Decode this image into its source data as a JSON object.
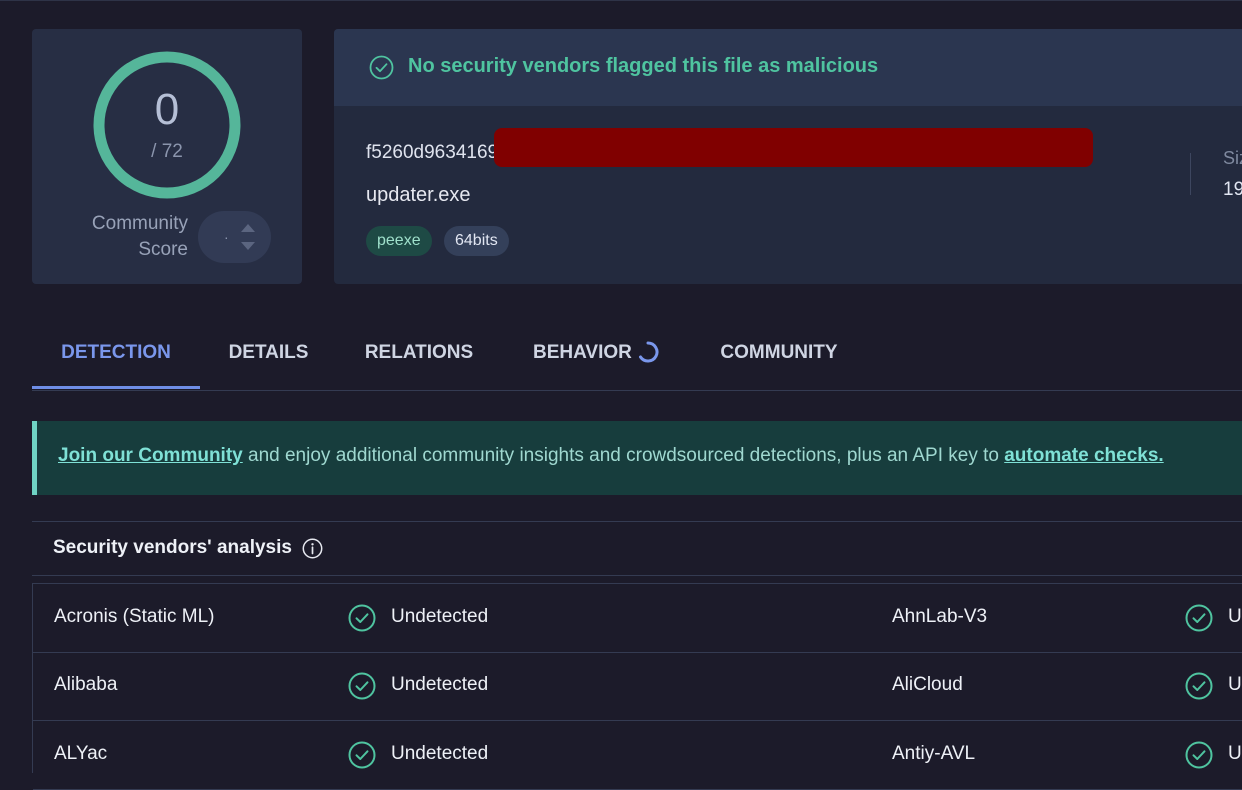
{
  "score": {
    "detections": "0",
    "total": "/ 72",
    "community_label": "Community Score",
    "vote_value": "·"
  },
  "summary": {
    "status": "No security vendors flagged this file as malicious",
    "hash_visible": "f5260d9634169",
    "file_name": "updater.exe",
    "tags": [
      "peexe",
      "64bits"
    ],
    "size_label": "Siz",
    "size_value": "19"
  },
  "tabs": [
    {
      "label": "DETECTION",
      "active": true
    },
    {
      "label": "DETAILS"
    },
    {
      "label": "RELATIONS"
    },
    {
      "label": "BEHAVIOR"
    },
    {
      "label": "COMMUNITY"
    }
  ],
  "banner": {
    "link1": "Join our Community",
    "middle": " and enjoy additional community insights and crowdsourced detections, plus an API key to ",
    "link2": "automate checks."
  },
  "vendors": {
    "title": "Security vendors' analysis",
    "rows": [
      {
        "left_name": "Acronis (Static ML)",
        "left_status": "Undetected",
        "right_name": "AhnLab-V3",
        "right_status": "U"
      },
      {
        "left_name": "Alibaba",
        "left_status": "Undetected",
        "right_name": "AliCloud",
        "right_status": "U"
      },
      {
        "left_name": "ALYac",
        "left_status": "Undetected",
        "right_name": "Antiy-AVL",
        "right_status": "U"
      }
    ]
  },
  "colors": {
    "ok_green": "#4fc4a0",
    "accent_blue": "#6f8ee6",
    "redaction": "#800000"
  }
}
